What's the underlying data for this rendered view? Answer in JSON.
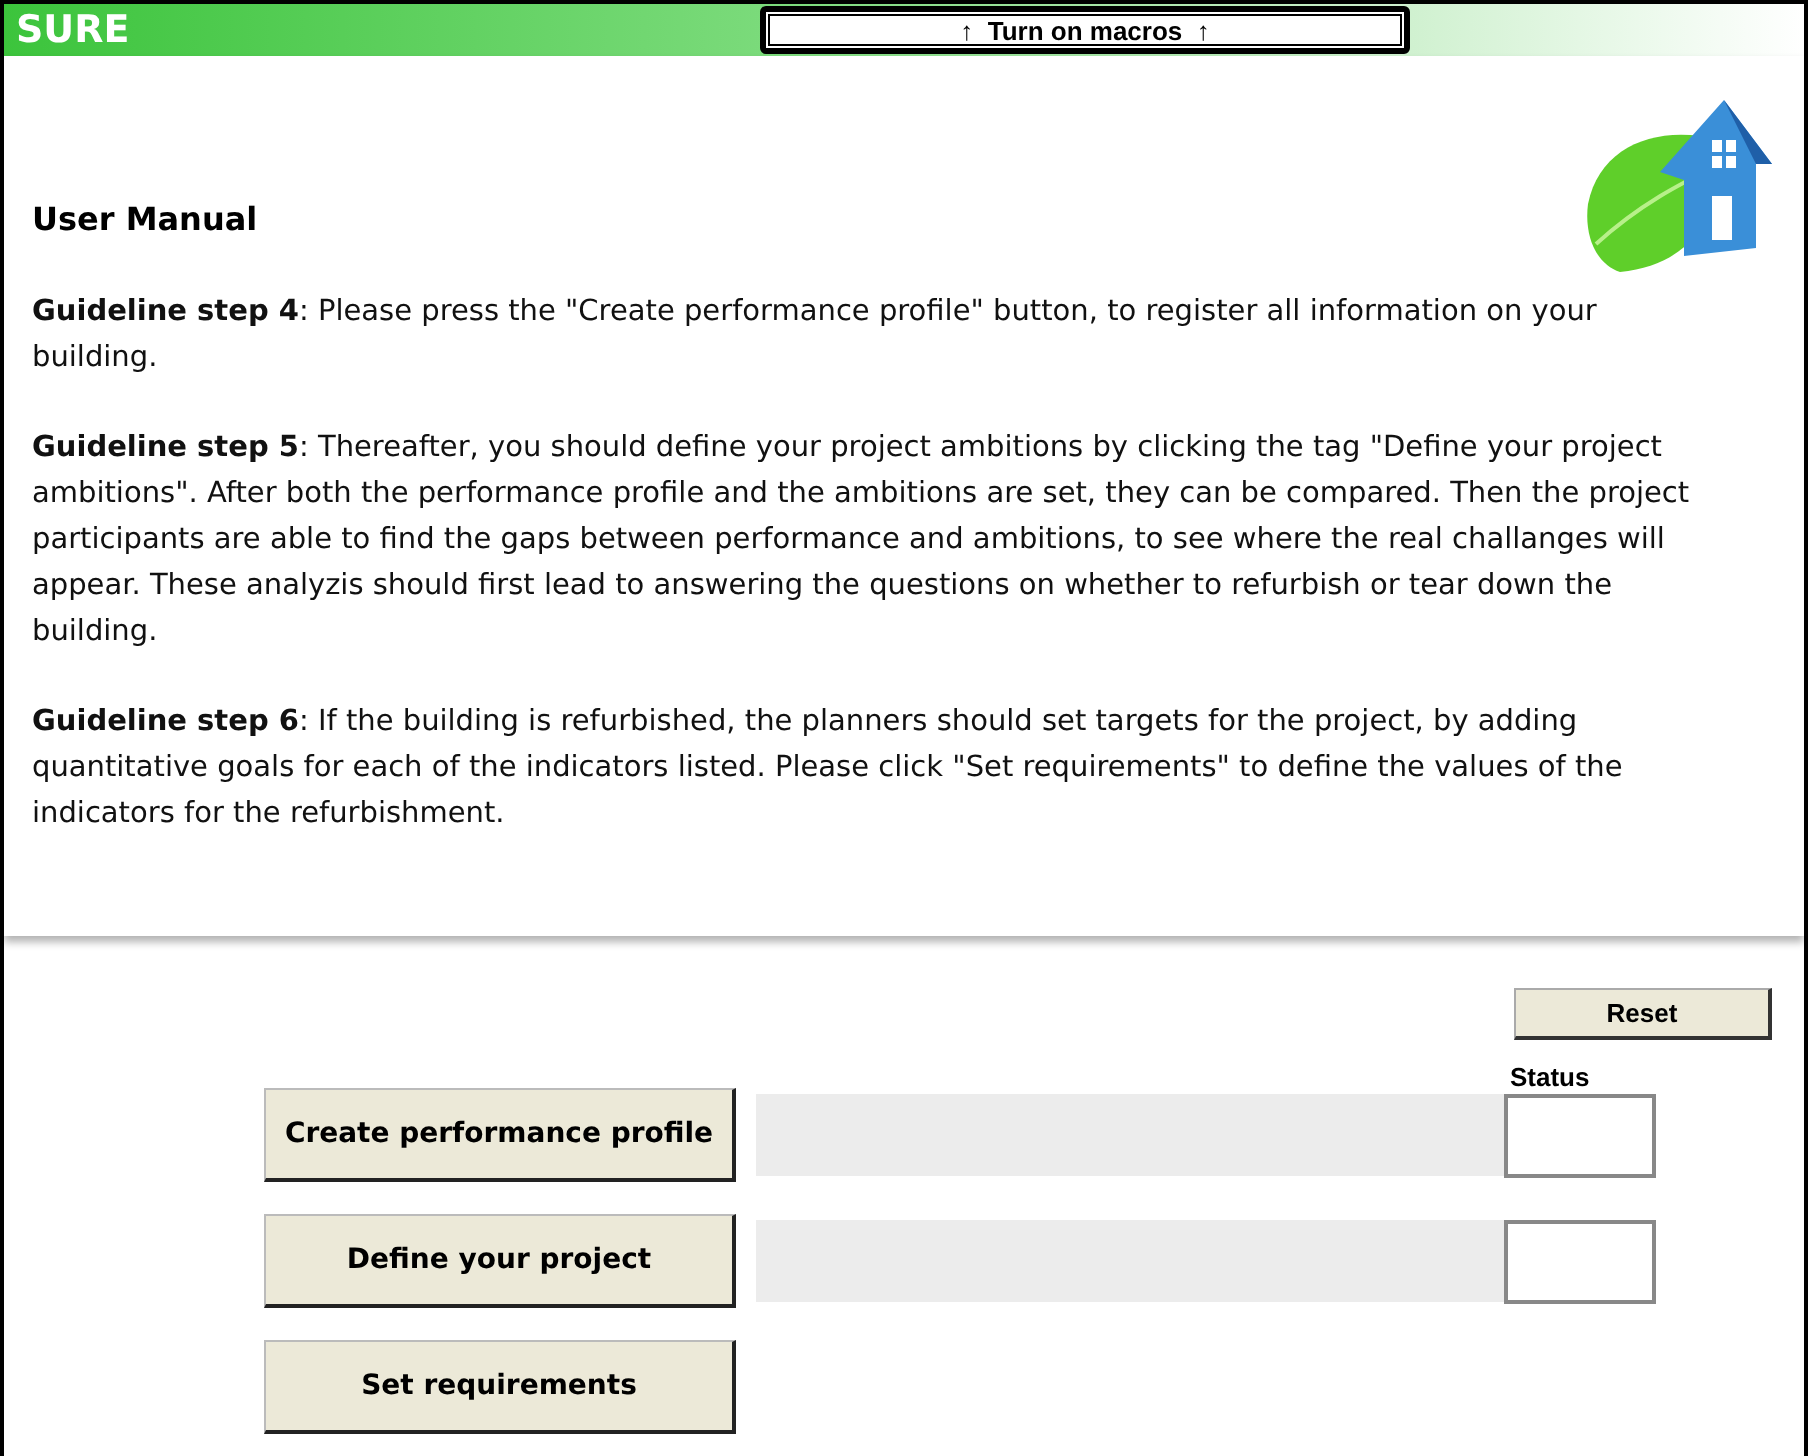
{
  "header": {
    "title": "SURE",
    "macro_button": "↑  Turn on macros  ↑"
  },
  "manual": {
    "title": "User Manual",
    "paragraphs": [
      "**Guideline step 4**: Please press the \"Create performance profile\" button, to register all information on your building.",
      "**Guideline step 5**: Thereafter, you should define your project ambitions by clicking the tag \"Define your project ambitions\". After both the performance profile and the ambitions are set, they can be compared. Then the project participants are able to find the gaps between performance and ambitions, to see where the real challanges will appear.  These analyzis should first lead to answering the questions on whether to refurbish or tear down the building.",
      "**Guideline step 6**: If the building is refurbished, the planners should set targets for the project, by adding quantitative goals for each of the indicators listed. Please click \"Set requirements\" to define the values of the indicators for the refurbishment."
    ]
  },
  "reset_button": "Reset",
  "status_label": "Status",
  "actions": [
    {
      "label": "Create performance profile",
      "kind": "with-status"
    },
    {
      "label": "Define your project",
      "kind": "with-status"
    },
    {
      "label": "Set requirements",
      "kind": "plain"
    }
  ]
}
